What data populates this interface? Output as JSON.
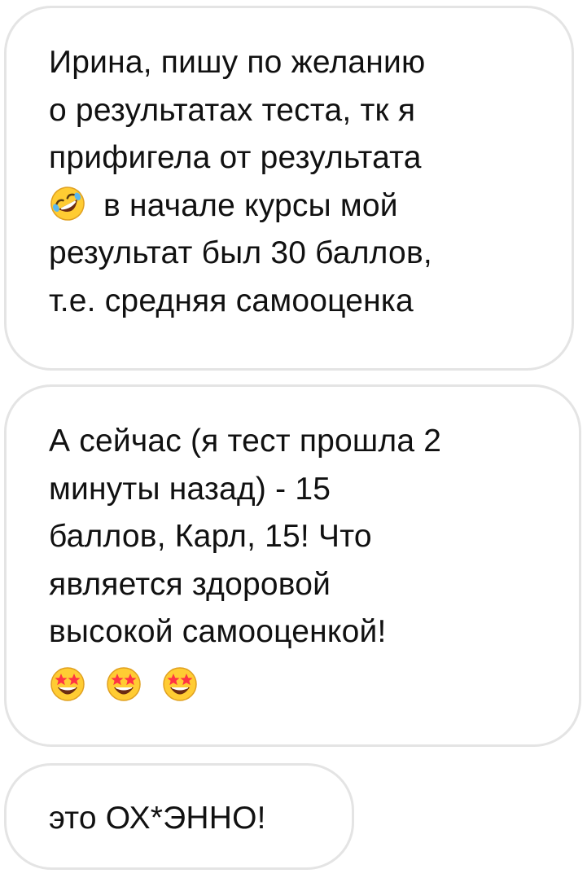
{
  "messages": [
    {
      "lines": [
        "Ирина, пишу по желанию",
        "о результатах теста, тк я",
        "прифигела от результата",
        "в начале курсы мой",
        "результат был 30 баллов,",
        "т.е. средняя самооценка"
      ],
      "emoji_line3": "rolling-on-floor-laughing-icon"
    },
    {
      "lines": [
        "А сейчас (я тест прошла 2",
        "минуты назад) - 15",
        "баллов, Карл, 15! Что",
        "является здоровой",
        "высокой самооценкой!"
      ],
      "emoji_row": [
        "star-struck-icon",
        "star-struck-icon",
        "star-struck-icon"
      ]
    },
    {
      "lines": [
        "это ОХ*ЭННО!"
      ]
    }
  ],
  "colors": {
    "bubble_border": "#e4e4e4",
    "text": "#111111",
    "emoji_face": "#ffcc33"
  }
}
